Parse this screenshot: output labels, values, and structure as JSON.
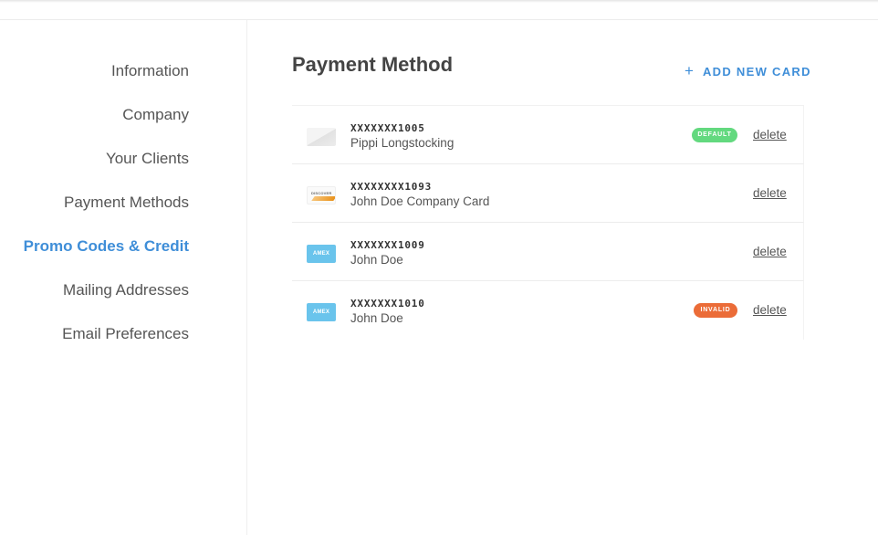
{
  "sidebar": {
    "items": [
      {
        "label": "Information",
        "active": false
      },
      {
        "label": "Company",
        "active": false
      },
      {
        "label": "Your Clients",
        "active": false
      },
      {
        "label": "Payment Methods",
        "active": false
      },
      {
        "label": "Promo Codes & Credit",
        "active": true
      },
      {
        "label": "Mailing Addresses",
        "active": false
      },
      {
        "label": "Email Preferences",
        "active": false
      }
    ]
  },
  "main": {
    "title": "Payment Method",
    "add_card_icon": "+",
    "add_card_label": "ADD NEW CARD",
    "cards": [
      {
        "number": "XXXXXXX1005",
        "name": "Pippi Longstocking",
        "brand": "generic",
        "badge": "DEFAULT",
        "delete_label": "delete"
      },
      {
        "number": "XXXXXXXX1093",
        "name": "John Doe Company Card",
        "brand": "discover",
        "brand_text": "DISCOVER",
        "badge": "",
        "delete_label": "delete"
      },
      {
        "number": "XXXXXXX1009",
        "name": "John Doe",
        "brand": "amex",
        "brand_text": "AMEX",
        "badge": "",
        "delete_label": "delete"
      },
      {
        "number": "XXXXXXX1010",
        "name": "John Doe",
        "brand": "amex",
        "brand_text": "AMEX",
        "badge": "INVALID",
        "delete_label": "delete"
      }
    ]
  },
  "colors": {
    "accent": "#3f8ed8",
    "default_badge": "#63d97f",
    "invalid_badge": "#eb6c38",
    "amex": "#6ac4ec"
  },
  "icons": {
    "add_card": "plus-icon",
    "generic_card": "generic-card-icon",
    "discover_card": "discover-card-icon",
    "amex_card": "amex-card-icon"
  }
}
